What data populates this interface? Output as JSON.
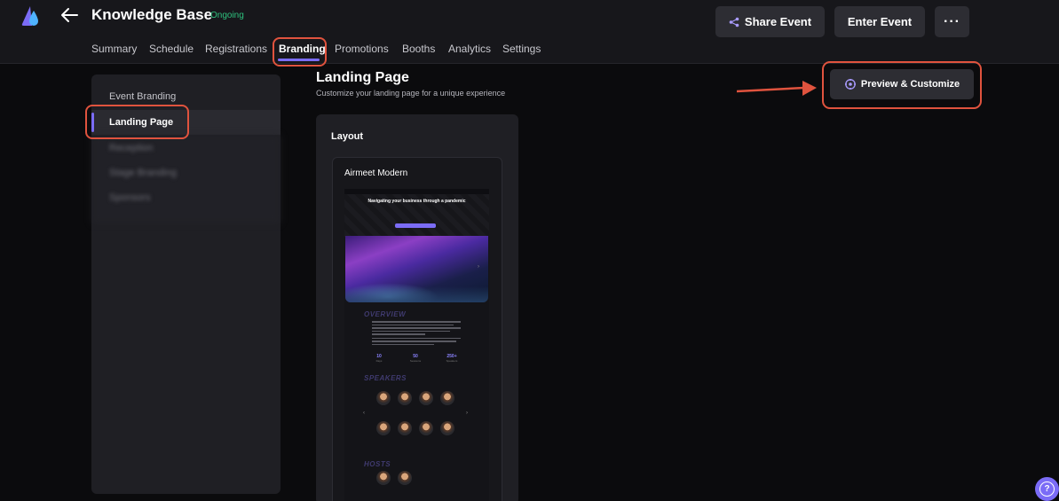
{
  "header": {
    "title": "Knowledge Base",
    "status": "Ongoing",
    "share_label": "Share Event",
    "enter_label": "Enter Event",
    "more_label": "···"
  },
  "tabs": [
    {
      "label": "Summary"
    },
    {
      "label": "Schedule"
    },
    {
      "label": "Registrations"
    },
    {
      "label": "Branding",
      "active": true
    },
    {
      "label": "Promotions"
    },
    {
      "label": "Booths"
    },
    {
      "label": "Analytics"
    },
    {
      "label": "Settings"
    }
  ],
  "sidebar": {
    "items": [
      {
        "label": "Event Branding"
      },
      {
        "label": "Landing Page",
        "active": true
      },
      {
        "label": "Reception"
      },
      {
        "label": "Stage Branding"
      },
      {
        "label": "Sponsors"
      }
    ]
  },
  "main": {
    "title": "Landing Page",
    "subtitle": "Customize your landing page for a unique experience",
    "preview_label": "Preview & Customize",
    "layout_title": "Layout",
    "template": {
      "name": "Airmeet Modern",
      "hero_title": "Navigating your business through a pandemic",
      "section_overview": "OVERVIEW",
      "section_speakers": "SPEAKERS",
      "section_hosts": "HOSTS",
      "stats": [
        {
          "value": "10",
          "label": "Days"
        },
        {
          "value": "50",
          "label": "Sessions"
        },
        {
          "value": "250+",
          "label": "Speakers"
        }
      ]
    }
  },
  "help_label": "?",
  "colors": {
    "accent": "#7b6cf6",
    "highlight": "#e0533e",
    "status_green": "#2ec27e"
  }
}
